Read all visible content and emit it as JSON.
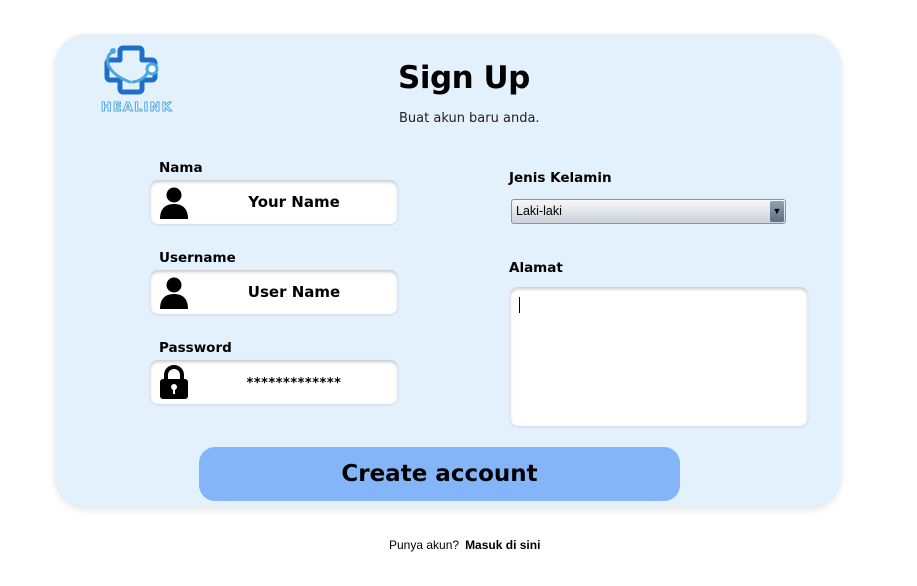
{
  "brand": {
    "logo_text": "HEALINK",
    "primary_color": "#1f6fc9",
    "accent_color": "#4aa9e3"
  },
  "header": {
    "title": "Sign Up",
    "subtitle": "Buat akun baru anda."
  },
  "form": {
    "nama": {
      "label": "Nama",
      "value": "Your Name",
      "icon": "user-icon"
    },
    "username": {
      "label": "Username",
      "value": "User Name",
      "icon": "user-icon"
    },
    "password": {
      "label": "Password",
      "value": "*************",
      "icon": "lock-icon"
    },
    "gender": {
      "label": "Jenis Kelamin",
      "selected": "Laki-laki"
    },
    "alamat": {
      "label": "Alamat",
      "value": ""
    }
  },
  "actions": {
    "create_label": "Create account",
    "button_color": "#84b5f9"
  },
  "footer": {
    "prompt": "Punya akun?",
    "link": "Masuk di sini"
  },
  "colors": {
    "card_bg": "#e3f1fd",
    "page_bg": "#ffffff"
  }
}
